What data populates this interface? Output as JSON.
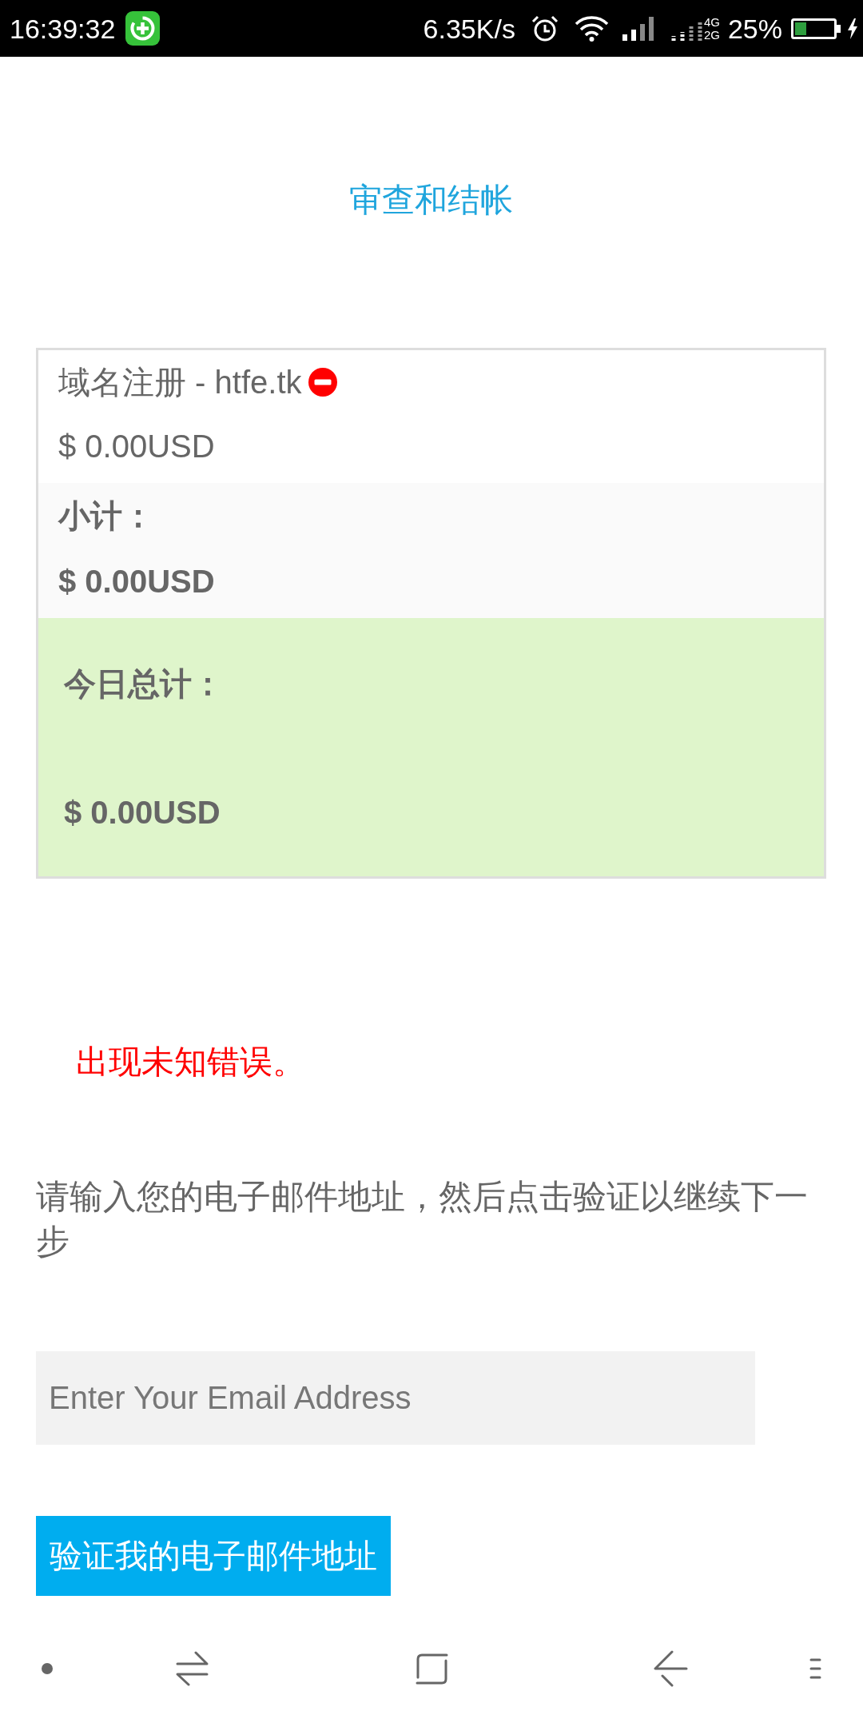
{
  "status_bar": {
    "time": "16:39:32",
    "network_speed": "6.35K/s",
    "network_types": [
      "4G",
      "2G"
    ],
    "battery_percent": "25%"
  },
  "page": {
    "title": "审查和结帐"
  },
  "cart": {
    "items": [
      {
        "name": "域名注册 - htfe.tk",
        "price": "$ 0.00USD"
      }
    ],
    "subtotal": {
      "label": "小计：",
      "amount": "$ 0.00USD"
    },
    "total": {
      "label": "今日总计：",
      "amount": "$ 0.00USD"
    }
  },
  "error": "出现未知错误。",
  "email_form": {
    "instruction": "请输入您的电子邮件地址，然后点击验证以继续下一步",
    "placeholder": "Enter Your Email Address",
    "button": "验证我的电子邮件地址"
  }
}
